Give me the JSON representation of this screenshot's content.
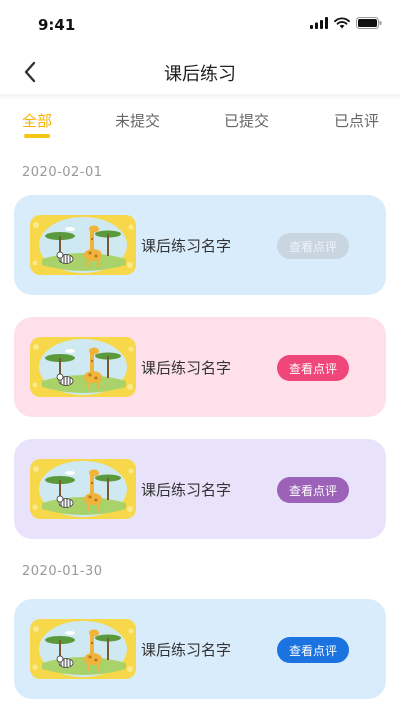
{
  "status_bar": {
    "time": "9:41"
  },
  "nav": {
    "title": "课后练习",
    "back_icon": "chevron-left-icon"
  },
  "tabs": [
    {
      "label": "全部",
      "active": true
    },
    {
      "label": "未提交",
      "active": false
    },
    {
      "label": "已提交",
      "active": false
    },
    {
      "label": "已点评",
      "active": false
    }
  ],
  "sections": [
    {
      "date": "2020-02-01",
      "items": [
        {
          "name": "课后练习名字",
          "button": "查看点评",
          "card_color": "#d9ecfc",
          "button_color": "#c9d6e2",
          "button_enabled": false
        },
        {
          "name": "课后练习名字",
          "button": "查看点评",
          "card_color": "#fde0ea",
          "button_color": "#f0467a",
          "button_enabled": true
        },
        {
          "name": "课后练习名字",
          "button": "查看点评",
          "card_color": "#e9e2fb",
          "button_color": "#9b62b7",
          "button_enabled": true
        }
      ]
    },
    {
      "date": "2020-01-30",
      "items": [
        {
          "name": "课后练习名字",
          "button": "查看点评",
          "card_color": "#d9ecfc",
          "button_color": "#1a73e0",
          "button_enabled": true
        }
      ]
    }
  ],
  "colors": {
    "accent": "#f5b400"
  }
}
